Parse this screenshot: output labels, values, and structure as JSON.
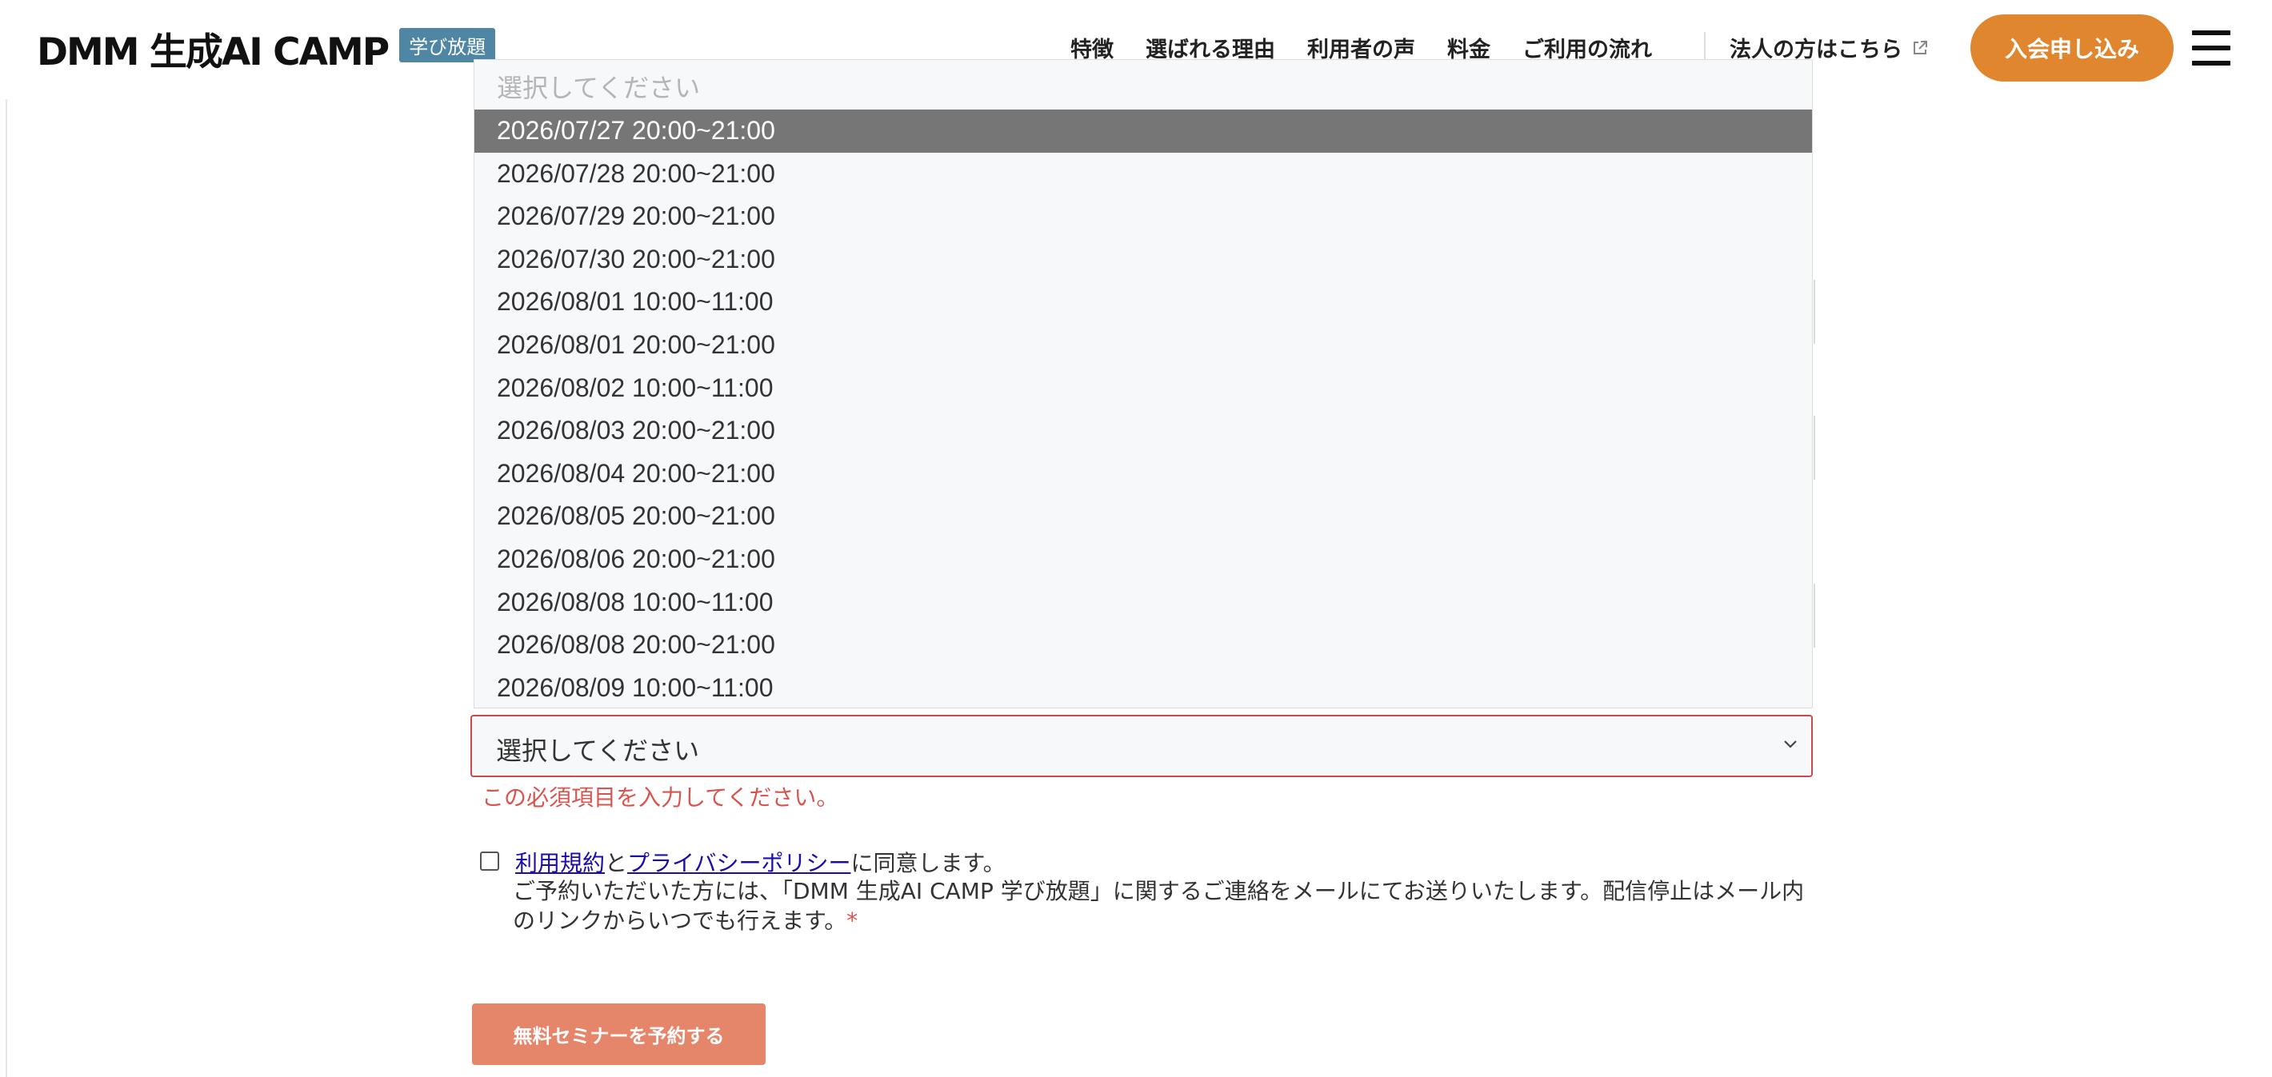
{
  "header": {
    "logo_text": "DMM 生成AI CAMP",
    "logo_badge": "学び放題",
    "nav": [
      {
        "label": "特徴"
      },
      {
        "label": "選ばれる理由"
      },
      {
        "label": "利用者の声"
      },
      {
        "label": "料金"
      },
      {
        "label": "ご利用の流れ"
      }
    ],
    "corporate_link": "法人の方はこちら",
    "join_button": "入会申し込み"
  },
  "dropdown": {
    "placeholder": "選択してください",
    "options": [
      {
        "label": "2026/07/27 20:00~21:00",
        "selected": true
      },
      {
        "label": "2026/07/28 20:00~21:00"
      },
      {
        "label": "2026/07/29 20:00~21:00"
      },
      {
        "label": "2026/07/30 20:00~21:00"
      },
      {
        "label": "2026/08/01 10:00~11:00"
      },
      {
        "label": "2026/08/01 20:00~21:00"
      },
      {
        "label": "2026/08/02 10:00~11:00"
      },
      {
        "label": "2026/08/03 20:00~21:00"
      },
      {
        "label": "2026/08/04 20:00~21:00"
      },
      {
        "label": "2026/08/05 20:00~21:00"
      },
      {
        "label": "2026/08/06 20:00~21:00"
      },
      {
        "label": "2026/08/08 10:00~11:00"
      },
      {
        "label": "2026/08/08 20:00~21:00"
      },
      {
        "label": "2026/08/09 10:00~11:00"
      }
    ]
  },
  "select": {
    "value": "選択してください",
    "error": "この必須項目を入力してください。"
  },
  "consent": {
    "terms_link": "利用規約",
    "connector": "と",
    "privacy_link": "プライバシーポリシー",
    "agree_suffix": "に同意します。",
    "notice": "ご予約いただいた方には、「DMM 生成AI CAMP 学び放題」に関するご連絡をメールにてお送りいたします。配信停止はメール内のリンクからいつでも行えます。",
    "required_mark": "*"
  },
  "submit_button": "無料セミナーを予約する",
  "colors": {
    "accent_orange": "#e0862f",
    "submit_salmon": "#e5856a",
    "badge_blue": "#4e86a4",
    "error_red": "#d9534f",
    "selected_option_bg": "#767676"
  }
}
